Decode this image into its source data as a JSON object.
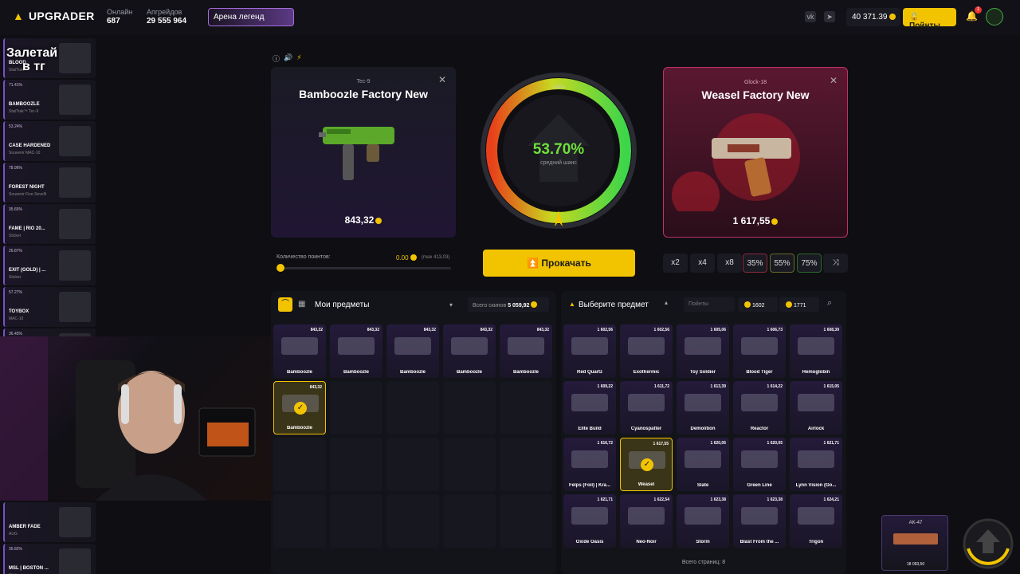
{
  "header": {
    "brand": "UPGRADER",
    "online_label": "Онлайн",
    "online_value": "687",
    "upgrades_label": "Апгрейдов",
    "upgrades_value": "29 555 964",
    "arena_label": "Арена легенд",
    "balance": "40 371.39",
    "points_button": "Пойнты",
    "notif_count": "1"
  },
  "overlay": {
    "line1": "Залетай",
    "line2": "в тг"
  },
  "sidebar": {
    "items": [
      {
        "pct": "",
        "name": "BLOOD",
        "sub": "StatTrak™"
      },
      {
        "pct": "71.41%",
        "name": "BAMBOOZLE",
        "sub": "StatTrak™ Tec-9"
      },
      {
        "pct": "53.24%",
        "name": "CASE HARDENED",
        "sub": "Souvenir MAC-10"
      },
      {
        "pct": "78.96%",
        "name": "FOREST NIGHT",
        "sub": "Souvenir Five-SeveN"
      },
      {
        "pct": "35.65%",
        "name": "FAME | RIO 20...",
        "sub": "Sticker"
      },
      {
        "pct": "26.87%",
        "name": "EXIT (GOLD) | ...",
        "sub": "Sticker"
      },
      {
        "pct": "57.27%",
        "name": "TOYBOX",
        "sub": "MAC-10"
      },
      {
        "pct": "36.45%",
        "name": "",
        "sub": ""
      }
    ],
    "bottom_items": [
      {
        "pct": "",
        "name": "AMBER FADE",
        "sub": "AUG"
      },
      {
        "pct": "35.82%",
        "name": "MSL | BOSTON ...",
        "sub": "Sticker"
      }
    ]
  },
  "left_card": {
    "type": "Tec-9",
    "title": "Bamboozle Factory New",
    "price": "843,32"
  },
  "right_card": {
    "type": "Glock-18",
    "title": "Weasel Factory New",
    "price": "1 617,55"
  },
  "gauge": {
    "percent": "53.70%",
    "label": "средний шанс",
    "top": "100%",
    "chance": 0.537
  },
  "slider": {
    "label": "Количество поинтов:",
    "value": "0.00",
    "max": "(max 413,03)"
  },
  "upgrade_button": "Прокачать",
  "multipliers": [
    "x2",
    "x4",
    "x8",
    "35%",
    "55%",
    "75%"
  ],
  "my_items": {
    "title": "Мои предметы",
    "total_label": "Всего скинов",
    "total_value": "5 059,92",
    "items": [
      {
        "price": "843,32",
        "wear": "FN",
        "name": "Bamboozle"
      },
      {
        "price": "843,32",
        "wear": "FN",
        "name": "Bamboozle"
      },
      {
        "price": "843,32",
        "wear": "FN",
        "name": "Bamboozle"
      },
      {
        "price": "843,32",
        "wear": "FN",
        "name": "Bamboozle"
      },
      {
        "price": "843,32",
        "wear": "FN",
        "name": "Bamboozle"
      },
      {
        "price": "843,32",
        "wear": "FN",
        "name": "Bamboozle"
      }
    ]
  },
  "select_items": {
    "title": "Выберите предмет",
    "search_placeholder": "Пойнты",
    "min": "1602",
    "max": "1771",
    "pages_label": "Всего страниц: 8",
    "items": [
      {
        "price": "1 602,56",
        "wear": "FT",
        "name": "Red Quartz"
      },
      {
        "price": "1 602,56",
        "wear": "",
        "name": "Exothermic"
      },
      {
        "price": "1 605,06",
        "wear": "FT",
        "name": "Toy Soldier"
      },
      {
        "price": "1 606,73",
        "wear": "FT",
        "name": "Blood Tiger"
      },
      {
        "price": "1 608,39",
        "wear": "FT",
        "name": "Hemoglobin"
      },
      {
        "price": "1 609,22",
        "wear": "FT",
        "name": "Elite Build"
      },
      {
        "price": "1 611,72",
        "wear": "FT",
        "name": "Cyanospatter"
      },
      {
        "price": "1 613,39",
        "wear": "WW",
        "name": "Demolition"
      },
      {
        "price": "1 614,22",
        "wear": "BS",
        "name": "Reactor"
      },
      {
        "price": "1 615,05",
        "wear": "MW",
        "name": "Airlock"
      },
      {
        "price": "1 616,72",
        "wear": "",
        "name": "Felps (Foil) | Kra..."
      },
      {
        "price": "1 617,55",
        "wear": "FN",
        "name": "Weasel"
      },
      {
        "price": "1 620,05",
        "wear": "FT",
        "name": "Slate"
      },
      {
        "price": "1 620,05",
        "wear": "FT",
        "name": "Green Line"
      },
      {
        "price": "1 621,71",
        "wear": "",
        "name": "Lynn Vision (Go..."
      },
      {
        "price": "1 621,71",
        "wear": "WW",
        "name": "Oxide Oasis"
      },
      {
        "price": "1 622,54",
        "wear": "MW",
        "name": "Neo-Noir"
      },
      {
        "price": "1 623,38",
        "wear": "FT",
        "name": "Storm"
      },
      {
        "price": "1 623,38",
        "wear": "FT",
        "name": "Blast From the ..."
      },
      {
        "price": "1 624,21",
        "wear": "FT",
        "name": "Trigon"
      }
    ]
  },
  "mini_card": {
    "type": "AK-47",
    "price": "18 093,50"
  },
  "colors": {
    "accent": "#f2c400",
    "bg": "#0e0e13",
    "panel": "#13131a",
    "purple": "#7b4fc7",
    "pink": "#c0306a"
  }
}
